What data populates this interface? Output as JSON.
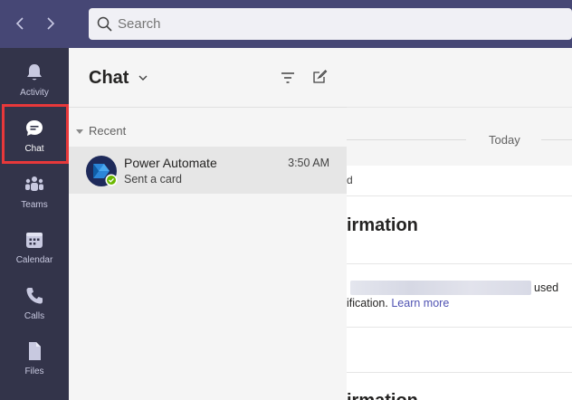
{
  "titlebar": {
    "back_icon": "chevron-left-icon",
    "forward_icon": "chevron-right-icon",
    "search": {
      "placeholder": "Search",
      "value": ""
    }
  },
  "rail": {
    "items": [
      {
        "label": "Activity",
        "icon": "bell-icon"
      },
      {
        "label": "Chat",
        "icon": "chat-bubble-icon",
        "active": true
      },
      {
        "label": "Teams",
        "icon": "teams-icon"
      },
      {
        "label": "Calendar",
        "icon": "calendar-icon"
      },
      {
        "label": "Calls",
        "icon": "phone-icon"
      },
      {
        "label": "Files",
        "icon": "file-icon"
      }
    ],
    "active_color": "#e8383a"
  },
  "chat_list": {
    "title": "Chat",
    "section_label": "Recent",
    "items": [
      {
        "name": "Power Automate",
        "time": "3:50 AM",
        "preview": "Sent a card",
        "status": "available"
      }
    ]
  },
  "conversation": {
    "date_divider": "Today",
    "card": {
      "sender_fragment": "d",
      "title_fragment": "irmation",
      "line1_suffix": "used",
      "line2_text": "ification. ",
      "link_text": "Learn more",
      "title2_fragment": "irmation"
    }
  },
  "colors": {
    "titlebar": "#464775",
    "rail": "#33344a",
    "accent": "#4f52b2"
  }
}
